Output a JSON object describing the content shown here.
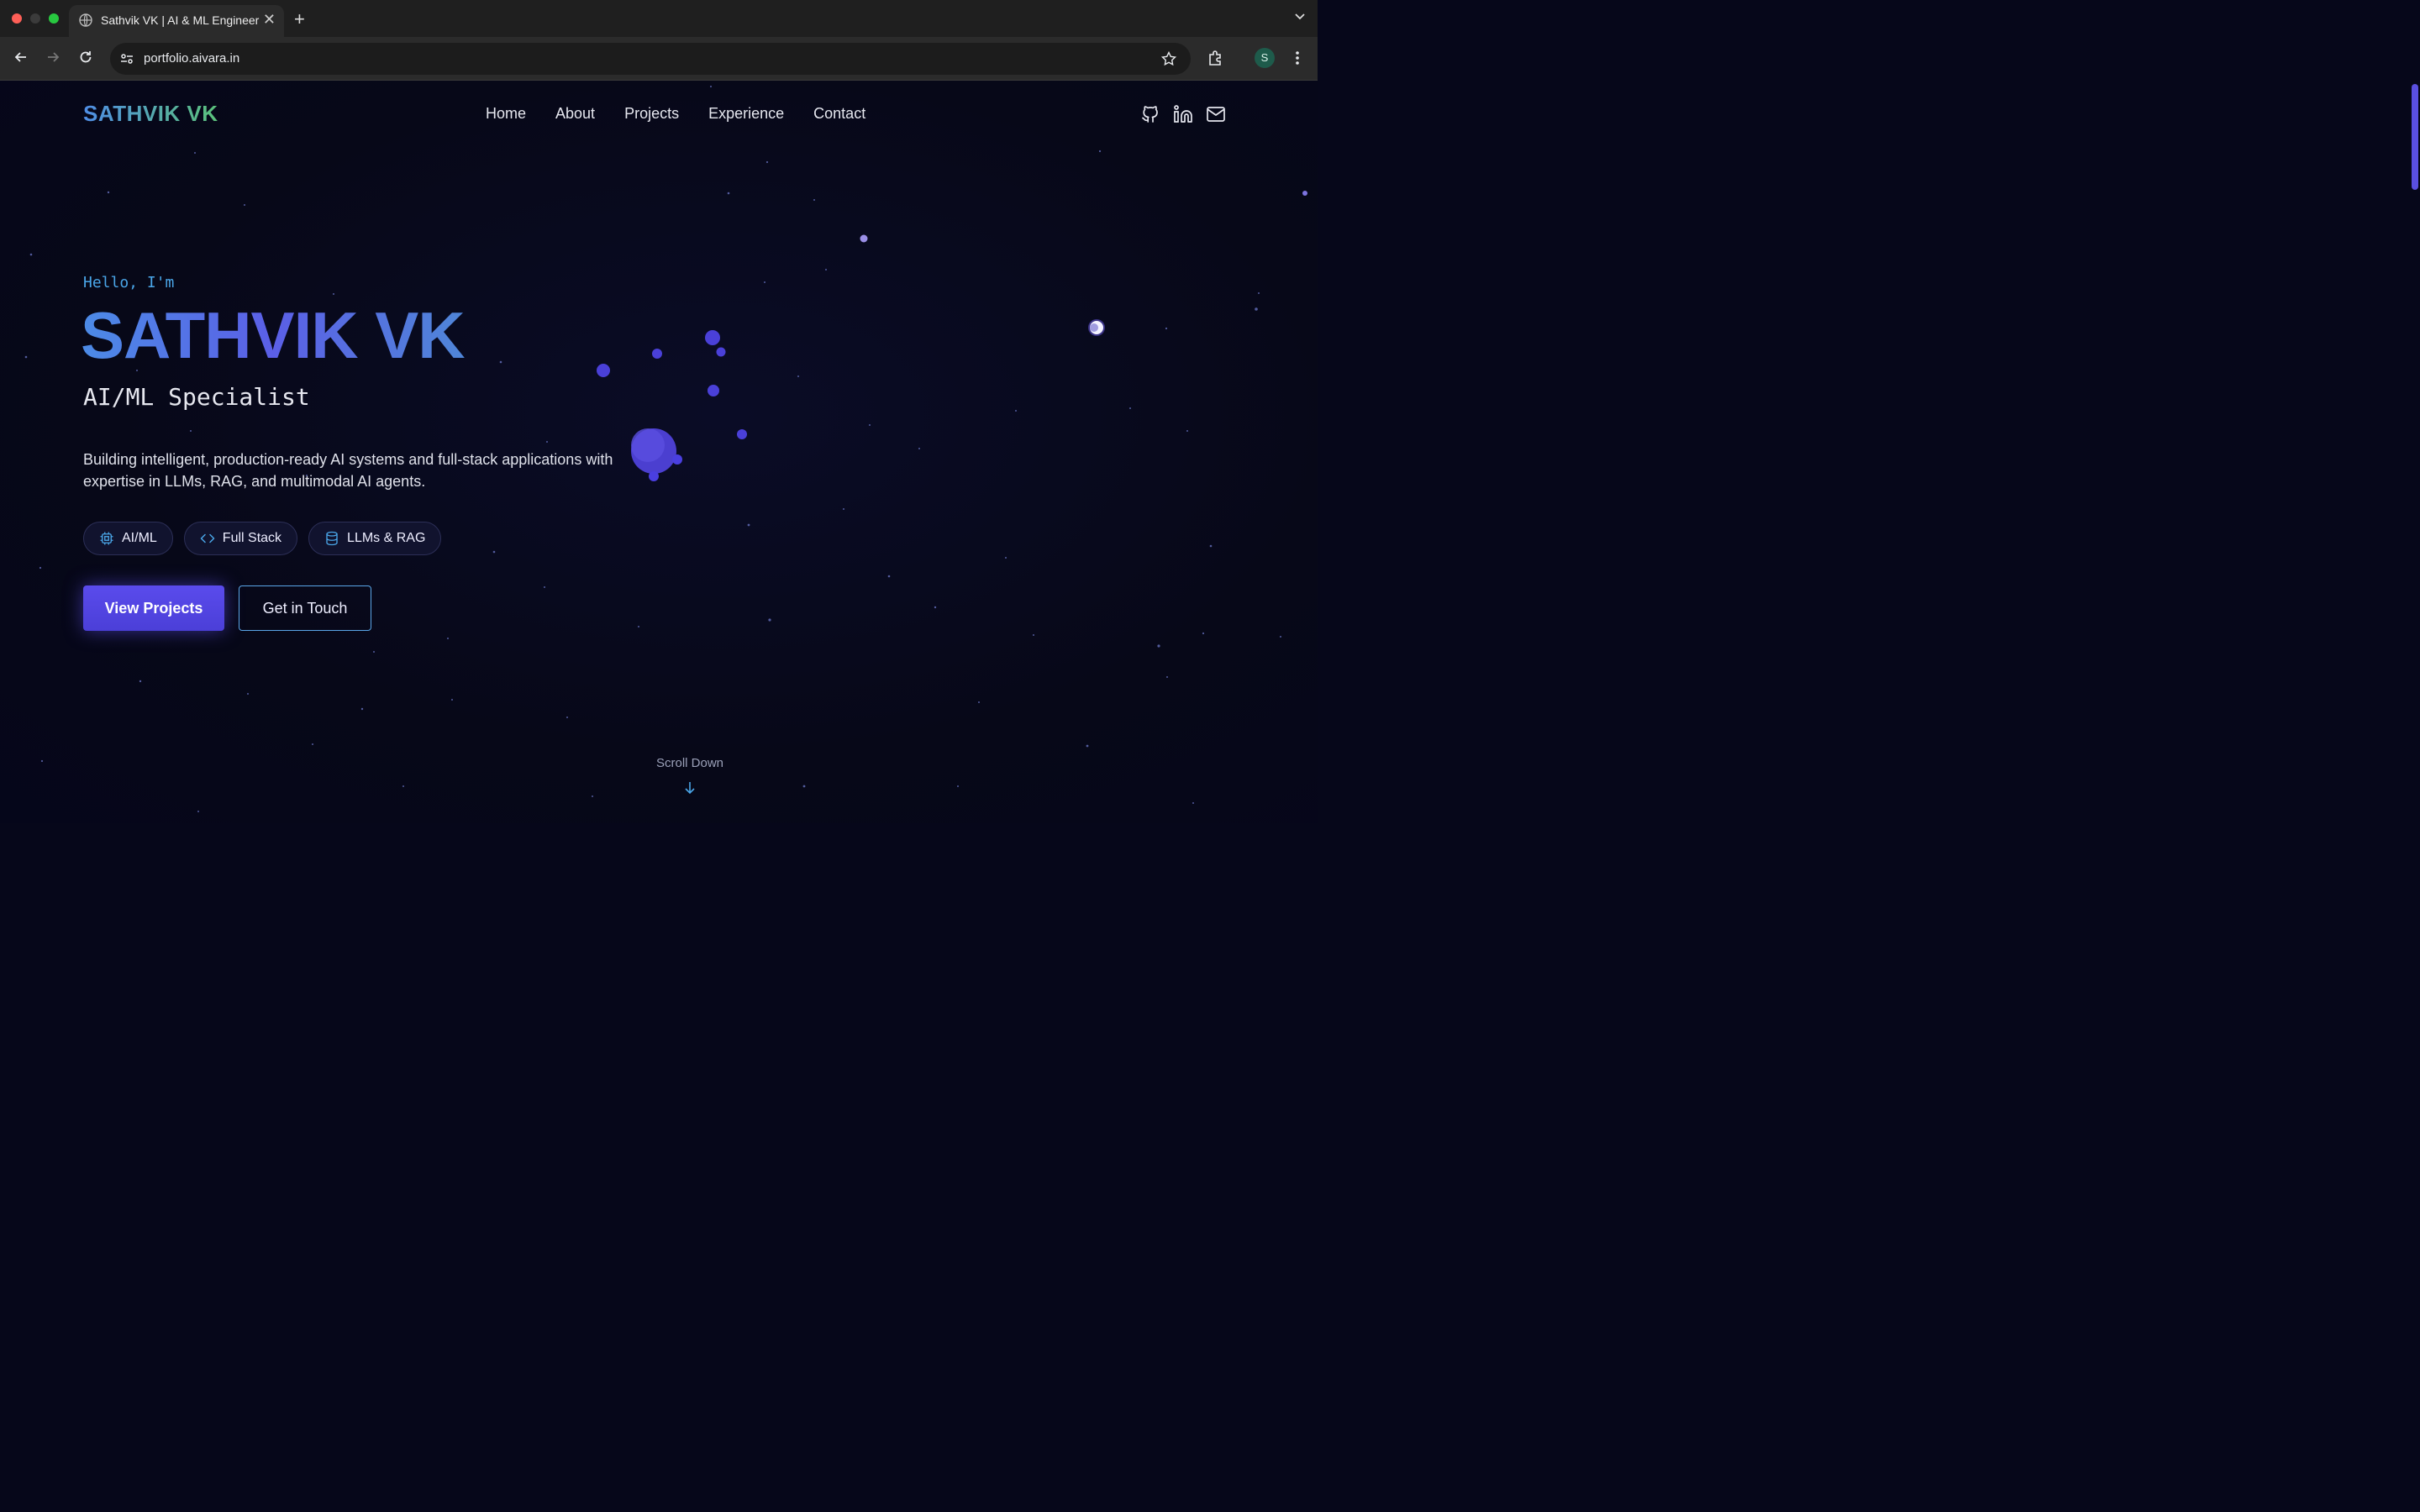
{
  "browser": {
    "tab_title": "Sathvik VK | AI & ML Engineer",
    "tab_close": "✕",
    "new_tab": "+",
    "url": "portfolio.aivara.in",
    "profile_initial": "S"
  },
  "site": {
    "logo": "SATHVIK VK",
    "nav": [
      "Home",
      "About",
      "Projects",
      "Experience",
      "Contact"
    ],
    "social_icons": [
      "github-icon",
      "linkedin-icon",
      "mail-icon"
    ]
  },
  "hero": {
    "greeting": "Hello, I'm",
    "name": "SATHVIK VK",
    "role": "AI/ML Specialist",
    "description": "Building intelligent, production-ready AI systems and full-stack applications with expertise in LLMs, RAG, and multimodal AI agents.",
    "chips": [
      {
        "label": "AI/ML",
        "icon": "cpu-icon"
      },
      {
        "label": "Full Stack",
        "icon": "code-icon"
      },
      {
        "label": "LLMs & RAG",
        "icon": "database-icon"
      }
    ],
    "primary_button": "View Projects",
    "secondary_button": "Get in Touch",
    "scroll_label": "Scroll Down"
  },
  "colors": {
    "background": "#06071a",
    "accent": "#5b4bec",
    "highlight": "#4aa6e8",
    "logo_gradient": [
      "#4f8de6",
      "#5bc27a"
    ]
  }
}
